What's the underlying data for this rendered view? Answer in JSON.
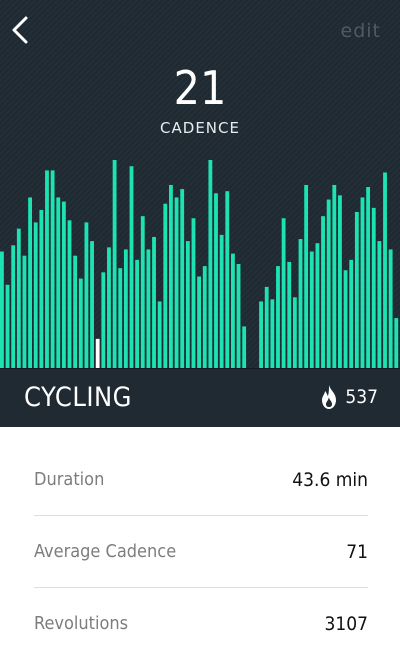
{
  "header": {
    "edit_label": "edit"
  },
  "metric": {
    "value": "21",
    "label": "CADENCE"
  },
  "chart_data": {
    "type": "bar",
    "ylim": [
      0,
      100
    ],
    "highlight_index": 17,
    "colors": {
      "bar": "#1de3b3",
      "highlight": "#ffffff"
    },
    "values": [
      56,
      40,
      59,
      67,
      54,
      82,
      70,
      76,
      95,
      95,
      82,
      80,
      71,
      54,
      43,
      70,
      61,
      14,
      46,
      58,
      100,
      48,
      57,
      97,
      52,
      73,
      57,
      63,
      32,
      79,
      88,
      82,
      86,
      61,
      72,
      44,
      49,
      100,
      84,
      64,
      85,
      55,
      50,
      20,
      0,
      0,
      32,
      39,
      33,
      49,
      72,
      51,
      34,
      62,
      88,
      56,
      60,
      73,
      81,
      88,
      83,
      47,
      52,
      75,
      82,
      87,
      77,
      61,
      94,
      57,
      24
    ]
  },
  "banner": {
    "activity": "CYCLING",
    "calorie_icon": "flame-icon",
    "calories": "537"
  },
  "stats": [
    {
      "label": "Duration",
      "value": "43.6 min"
    },
    {
      "label": "Average Cadence",
      "value": "71"
    },
    {
      "label": "Revolutions",
      "value": "3107"
    }
  ]
}
